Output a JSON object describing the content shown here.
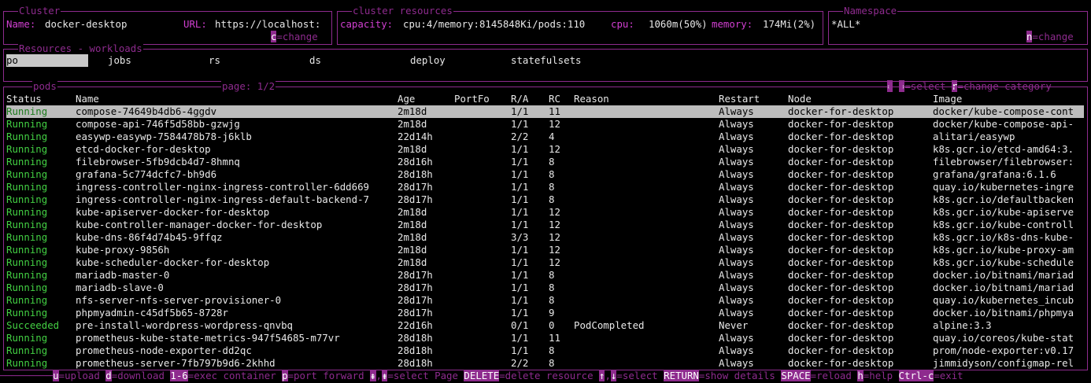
{
  "cluster": {
    "legend": "Cluster",
    "name_label": "Name:",
    "name_value": "docker-desktop",
    "url_label": "URL:",
    "url_value": "https://localhost:",
    "change_key": "c",
    "change_text": "=change"
  },
  "resources": {
    "legend": "cluster resources",
    "capacity_label": "capacity:",
    "capacity_value": "cpu:4/memory:8145848Ki/pods:110",
    "cpu_label": "cpu:",
    "cpu_value": "1060m(50%)",
    "memory_label": "memory:",
    "memory_value": "174Mi(2%)"
  },
  "namespace": {
    "legend": "Namespace",
    "value": "*ALL*",
    "change_key": "n",
    "change_text": "=change"
  },
  "workloads": {
    "legend": "Resources - workloads",
    "tabs": [
      "po",
      "jobs",
      "rs",
      "ds",
      "deploy",
      "statefulsets"
    ],
    "selected_tab": "po",
    "hint": {
      "left_key": "←",
      "sep": " ",
      "right_key": "→",
      "select_text": "=select ",
      "r_key": "r",
      "category_text": "=change category"
    }
  },
  "pods": {
    "legend": "pods",
    "page": "page: 1/2",
    "columns": [
      "Status",
      "Name",
      "Age",
      "PortFo",
      "R/A",
      "RC",
      "Reason",
      "Restart",
      "Node",
      "Image"
    ],
    "rows": [
      [
        "Running",
        "compose-74649b4db6-4ggdv",
        "2m18d",
        "",
        "1/1",
        "11",
        "",
        "Always",
        "docker-for-desktop",
        "docker/kube-compose-cont"
      ],
      [
        "Running",
        "compose-api-746f5d58bb-gzwjg",
        "2m18d",
        "",
        "1/1",
        "12",
        "",
        "Always",
        "docker-for-desktop",
        "docker/kube-compose-api-"
      ],
      [
        "Running",
        "easywp-easywp-7584478b78-j6klb",
        "22d14h",
        "",
        "2/2",
        "4",
        "",
        "Always",
        "docker-for-desktop",
        "alitari/easywp"
      ],
      [
        "Running",
        "etcd-docker-for-desktop",
        "2m18d",
        "",
        "1/1",
        "12",
        "",
        "Always",
        "docker-for-desktop",
        "k8s.gcr.io/etcd-amd64:3."
      ],
      [
        "Running",
        "filebrowser-5fb9dcb4d7-8hmnq",
        "28d16h",
        "",
        "1/1",
        "8",
        "",
        "Always",
        "docker-for-desktop",
        "filebrowser/filebrowser:"
      ],
      [
        "Running",
        "grafana-5c774dcfc7-bh9d6",
        "28d18h",
        "",
        "1/1",
        "8",
        "",
        "Always",
        "docker-for-desktop",
        "grafana/grafana:6.1.6"
      ],
      [
        "Running",
        "ingress-controller-nginx-ingress-controller-6dd669",
        "28d17h",
        "",
        "1/1",
        "8",
        "",
        "Always",
        "docker-for-desktop",
        "quay.io/kubernetes-ingre"
      ],
      [
        "Running",
        "ingress-controller-nginx-ingress-default-backend-7",
        "28d17h",
        "",
        "1/1",
        "8",
        "",
        "Always",
        "docker-for-desktop",
        "k8s.gcr.io/defaultbacken"
      ],
      [
        "Running",
        "kube-apiserver-docker-for-desktop",
        "2m18d",
        "",
        "1/1",
        "12",
        "",
        "Always",
        "docker-for-desktop",
        "k8s.gcr.io/kube-apiserve"
      ],
      [
        "Running",
        "kube-controller-manager-docker-for-desktop",
        "2m18d",
        "",
        "1/1",
        "12",
        "",
        "Always",
        "docker-for-desktop",
        "k8s.gcr.io/kube-controll"
      ],
      [
        "Running",
        "kube-dns-86f4d74b45-9ffqz",
        "2m18d",
        "",
        "3/3",
        "12",
        "",
        "Always",
        "docker-for-desktop",
        "k8s.gcr.io/k8s-dns-kube-"
      ],
      [
        "Running",
        "kube-proxy-9856h",
        "2m18d",
        "",
        "1/1",
        "12",
        "",
        "Always",
        "docker-for-desktop",
        "k8s.gcr.io/kube-proxy-am"
      ],
      [
        "Running",
        "kube-scheduler-docker-for-desktop",
        "2m18d",
        "",
        "1/1",
        "12",
        "",
        "Always",
        "docker-for-desktop",
        "k8s.gcr.io/kube-schedule"
      ],
      [
        "Running",
        "mariadb-master-0",
        "28d17h",
        "",
        "1/1",
        "8",
        "",
        "Always",
        "docker-for-desktop",
        "docker.io/bitnami/mariad"
      ],
      [
        "Running",
        "mariadb-slave-0",
        "28d17h",
        "",
        "1/1",
        "8",
        "",
        "Always",
        "docker-for-desktop",
        "docker.io/bitnami/mariad"
      ],
      [
        "Running",
        "nfs-server-nfs-server-provisioner-0",
        "28d17h",
        "",
        "1/1",
        "8",
        "",
        "Always",
        "docker-for-desktop",
        "quay.io/kubernetes_incub"
      ],
      [
        "Running",
        "phpmyadmin-c45df5b65-8728r",
        "28d17h",
        "",
        "1/1",
        "9",
        "",
        "Always",
        "docker-for-desktop",
        "docker.io/bitnami/phpmya"
      ],
      [
        "Succeeded",
        "pre-install-wordpress-wordpress-qnvbq",
        "22d16h",
        "",
        "0/1",
        "0",
        "PodCompleted",
        "Never",
        "docker-for-desktop",
        "alpine:3.3"
      ],
      [
        "Running",
        "prometheus-kube-state-metrics-947f54685-m77vr",
        "28d18h",
        "",
        "1/1",
        "11",
        "",
        "Always",
        "docker-for-desktop",
        "quay.io/coreos/kube-stat"
      ],
      [
        "Running",
        "prometheus-node-exporter-dd2qc",
        "28d18h",
        "",
        "1/1",
        "8",
        "",
        "Always",
        "docker-for-desktop",
        "prom/node-exporter:v0.17"
      ],
      [
        "Running",
        "prometheus-server-7fb797b9d6-2khhd",
        "28d18h",
        "",
        "2/2",
        "8",
        "",
        "Always",
        "docker-for-desktop",
        "jimmidyson/configmap-rel"
      ]
    ]
  },
  "footer": [
    {
      "key": "u",
      "text": "=upload "
    },
    {
      "key": "d",
      "text": "=download "
    },
    {
      "key": "1-6",
      "text": "=exec container "
    },
    {
      "key": "p",
      "text": "=port forward "
    },
    {
      "key": "⇞",
      "text": ","
    },
    {
      "key": "⇟",
      "text": "=select Page "
    },
    {
      "key": "DELETE",
      "text": "=delete resource "
    },
    {
      "key": "↑",
      "text": ","
    },
    {
      "key": "↓",
      "text": "=select "
    },
    {
      "key": "RETURN",
      "text": "=show details "
    },
    {
      "key": "SPACE",
      "text": "=reload "
    },
    {
      "key": "h",
      "text": "=help "
    },
    {
      "key": "Ctrl-c",
      "text": "=exit"
    }
  ],
  "colors": {
    "border": "#8e2b8e",
    "label": "#d13fd1",
    "running": "#43d043",
    "selection": "#bdbdbd"
  }
}
